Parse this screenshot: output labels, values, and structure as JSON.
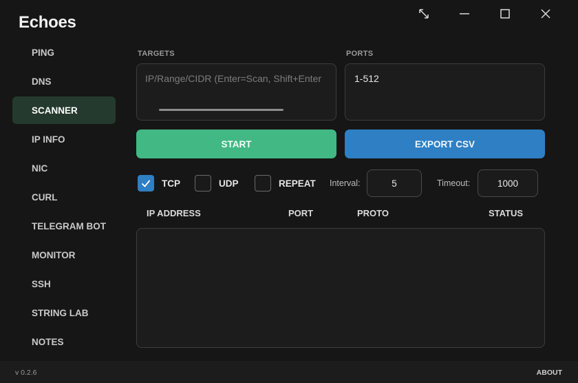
{
  "app": {
    "title": "Echoes",
    "version": "v 0.2.6",
    "about_label": "ABOUT"
  },
  "window_controls": [
    "expand-icon",
    "minimize-icon",
    "maximize-icon",
    "close-icon"
  ],
  "sidebar": {
    "items": [
      {
        "label": "PING",
        "active": false
      },
      {
        "label": "DNS",
        "active": false
      },
      {
        "label": "SCANNER",
        "active": true
      },
      {
        "label": "IP INFO",
        "active": false
      },
      {
        "label": "NIC",
        "active": false
      },
      {
        "label": "CURL",
        "active": false
      },
      {
        "label": "TELEGRAM BOT",
        "active": false
      },
      {
        "label": "MONITOR",
        "active": false
      },
      {
        "label": "SSH",
        "active": false
      },
      {
        "label": "STRING LAB",
        "active": false
      },
      {
        "label": "NOTES",
        "active": false
      }
    ]
  },
  "scanner": {
    "targets_label": "TARGETS",
    "targets_placeholder": "IP/Range/CIDR (Enter=Scan, Shift+Enter",
    "ports_label": "PORTS",
    "ports_value": "1-512",
    "start_label": "START",
    "export_label": "EXPORT CSV",
    "options": {
      "tcp": {
        "label": "TCP",
        "checked": true
      },
      "udp": {
        "label": "UDP",
        "checked": false
      },
      "repeat": {
        "label": "REPEAT",
        "checked": false
      }
    },
    "interval_label": "Interval:",
    "interval_value": "5",
    "timeout_label": "Timeout:",
    "timeout_value": "1000",
    "columns": [
      "IP ADDRESS",
      "PORT",
      "PROTO",
      "STATUS"
    ],
    "rows": []
  },
  "colors": {
    "background": "#161616",
    "active_nav": "#243a2e",
    "start_button": "#42b884",
    "export_button": "#2f7fc4",
    "checkbox_on": "#2f7fc4"
  }
}
